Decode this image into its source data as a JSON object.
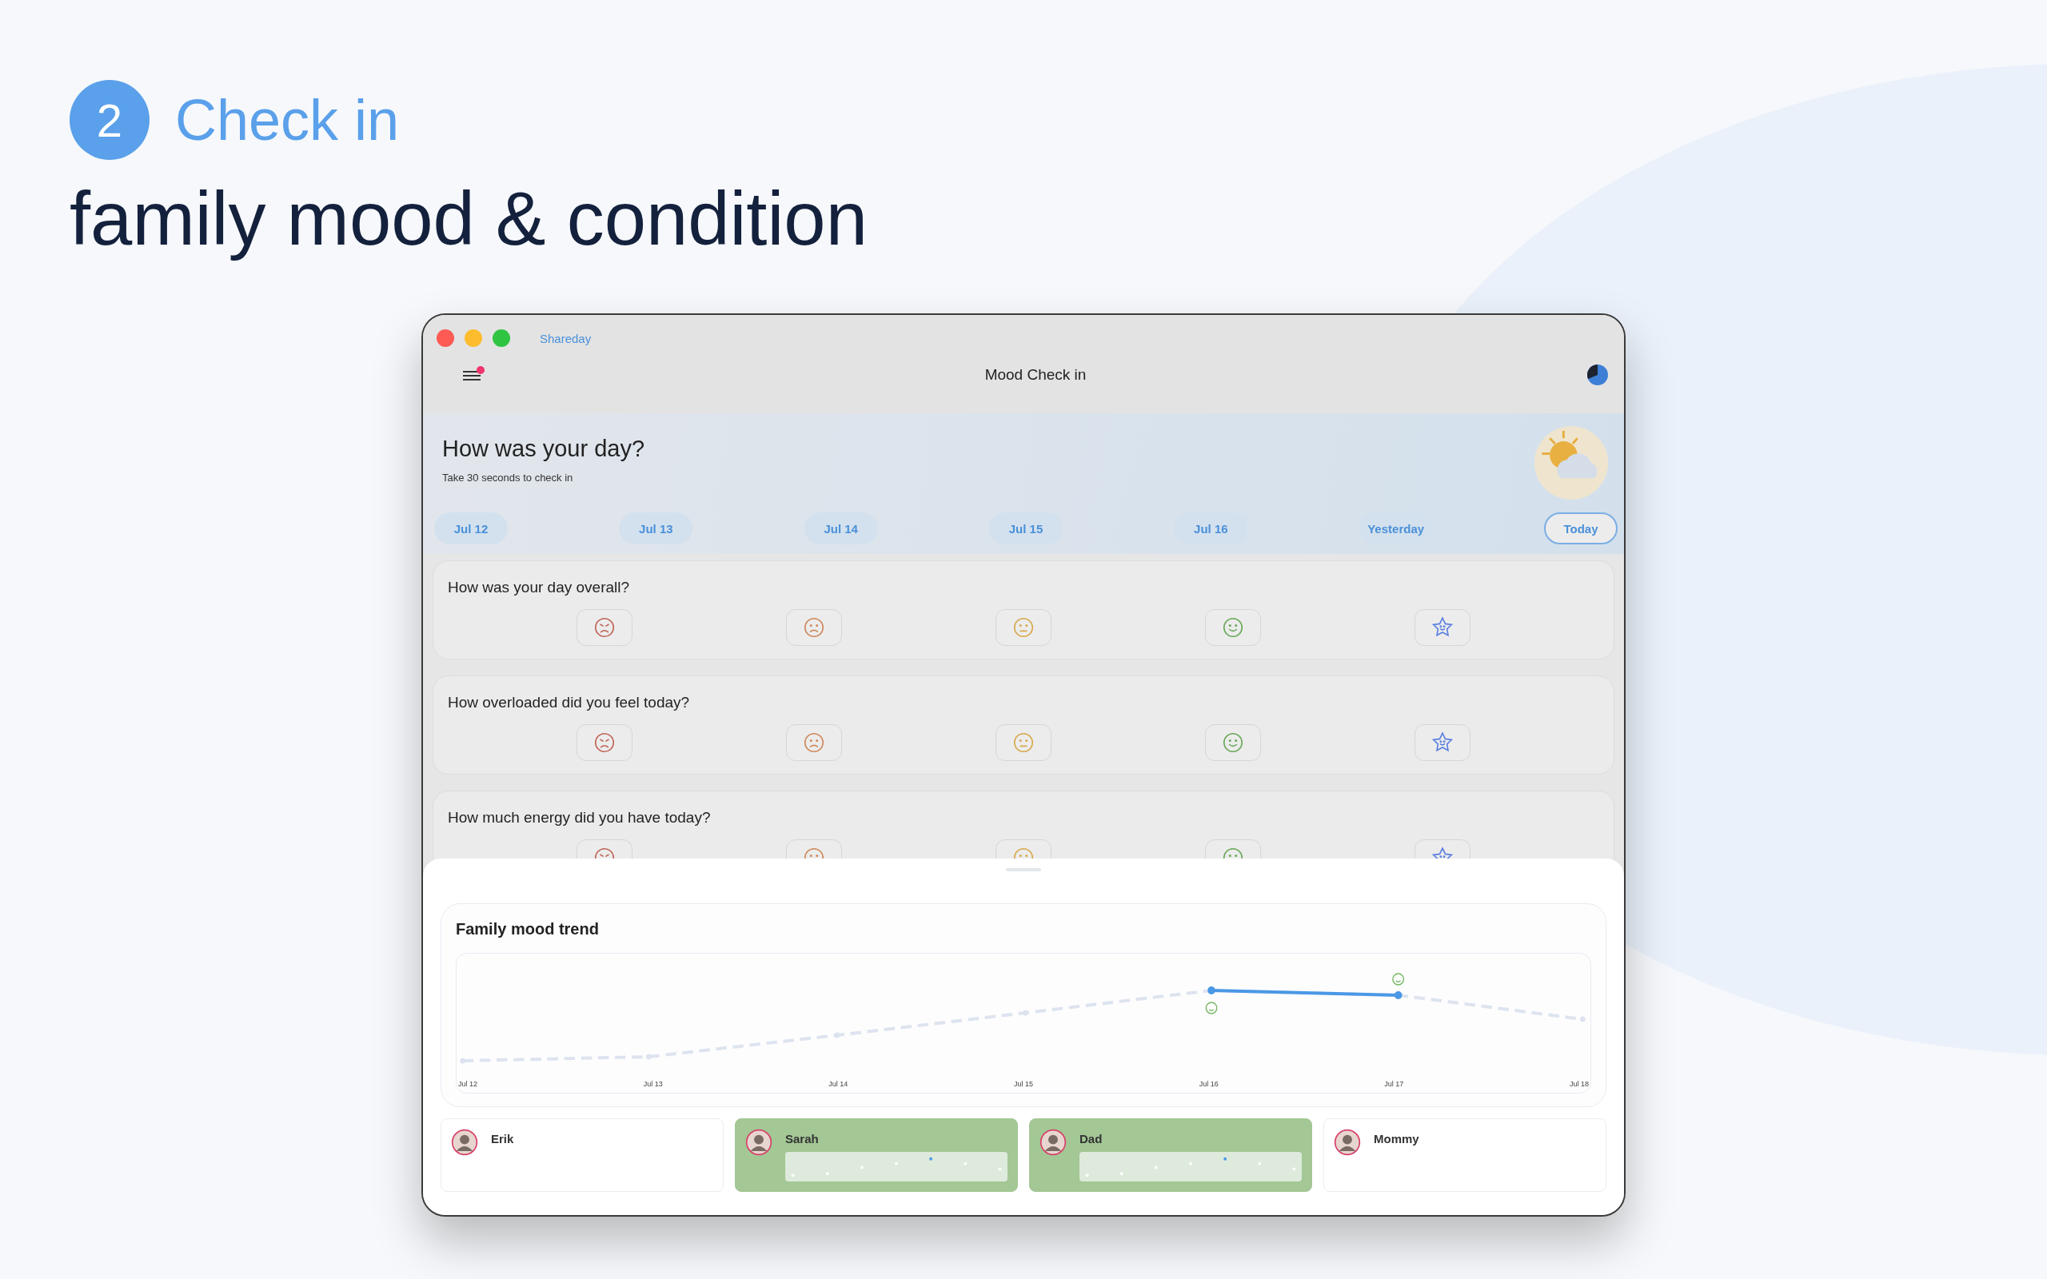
{
  "hero": {
    "step": "2",
    "label": "Check in",
    "headline": "family mood & condition"
  },
  "window": {
    "app_name": "Shareday",
    "title": "Mood Check in"
  },
  "menu": {
    "notification": true
  },
  "checkin": {
    "title": "How was your day?",
    "subtitle": "Take 30 seconds to check in"
  },
  "dates": [
    {
      "label": "Jul 12",
      "selected": false
    },
    {
      "label": "Jul 13",
      "selected": false
    },
    {
      "label": "Jul 14",
      "selected": false
    },
    {
      "label": "Jul 15",
      "selected": false
    },
    {
      "label": "Jul 16",
      "selected": false
    },
    {
      "label": "Yesterday",
      "selected": false
    },
    {
      "label": "Today",
      "selected": true
    }
  ],
  "questions": [
    {
      "text": "How was your day overall?",
      "options": [
        {
          "kind": "angry",
          "selected": false
        },
        {
          "kind": "sad",
          "selected": false
        },
        {
          "kind": "neutral",
          "selected": false
        },
        {
          "kind": "happy",
          "selected": false
        },
        {
          "kind": "star",
          "selected": false
        }
      ]
    },
    {
      "text": "How overloaded did you feel today?",
      "options": [
        {
          "kind": "angry",
          "selected": false
        },
        {
          "kind": "sad",
          "selected": false
        },
        {
          "kind": "neutral",
          "selected": false
        },
        {
          "kind": "happy",
          "selected": false
        },
        {
          "kind": "star",
          "selected": false
        }
      ]
    },
    {
      "text": "How much energy did you have today?",
      "options": [
        {
          "kind": "angry",
          "selected": false
        },
        {
          "kind": "sad",
          "selected": false
        },
        {
          "kind": "neutral",
          "selected": false
        },
        {
          "kind": "happy",
          "selected": false
        },
        {
          "kind": "star",
          "selected": false
        }
      ]
    }
  ],
  "trend": {
    "title": "Family mood trend",
    "x_labels": [
      "Jul 12",
      "Jul 13",
      "Jul 14",
      "Jul 15",
      "Jul 16",
      "Jul 17",
      "Jul 18"
    ]
  },
  "members": [
    {
      "name": "Erik",
      "active": false
    },
    {
      "name": "Sarah",
      "active": true
    },
    {
      "name": "Dad",
      "active": true
    },
    {
      "name": "Mommy",
      "active": false
    }
  ]
}
